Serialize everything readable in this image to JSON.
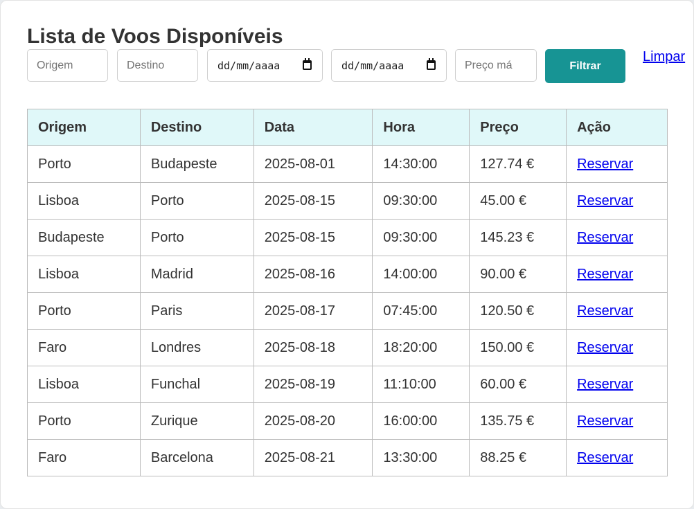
{
  "page": {
    "title": "Lista de Voos Disponíveis"
  },
  "filters": {
    "origin_placeholder": "Origem",
    "destination_placeholder": "Destino",
    "date_from_placeholder": "dd/mm/aaaa",
    "date_to_placeholder": "dd/mm/aaaa",
    "price_placeholder": "Preço má",
    "filter_label": "Filtrar",
    "clear_label": "Limpar"
  },
  "table": {
    "headers": [
      "Origem",
      "Destino",
      "Data",
      "Hora",
      "Preço",
      "Ação"
    ],
    "action_label": "Reservar",
    "rows": [
      [
        "Porto",
        "Budapeste",
        "2025-08-01",
        "14:30:00",
        "127.74 €"
      ],
      [
        "Lisboa",
        "Porto",
        "2025-08-15",
        "09:30:00",
        "45.00 €"
      ],
      [
        "Budapeste",
        "Porto",
        "2025-08-15",
        "09:30:00",
        "145.23 €"
      ],
      [
        "Lisboa",
        "Madrid",
        "2025-08-16",
        "14:00:00",
        "90.00 €"
      ],
      [
        "Porto",
        "Paris",
        "2025-08-17",
        "07:45:00",
        "120.50 €"
      ],
      [
        "Faro",
        "Londres",
        "2025-08-18",
        "18:20:00",
        "150.00 €"
      ],
      [
        "Lisboa",
        "Funchal",
        "2025-08-19",
        "11:10:00",
        "60.00 €"
      ],
      [
        "Porto",
        "Zurique",
        "2025-08-20",
        "16:00:00",
        "135.75 €"
      ],
      [
        "Faro",
        "Barcelona",
        "2025-08-21",
        "13:30:00",
        "88.25 €"
      ]
    ]
  },
  "colors": {
    "accent": "#179494",
    "header_bg": "#e0f8f9",
    "link": "#0000ee"
  },
  "icons": {
    "date_picker": "calendar-icon"
  }
}
